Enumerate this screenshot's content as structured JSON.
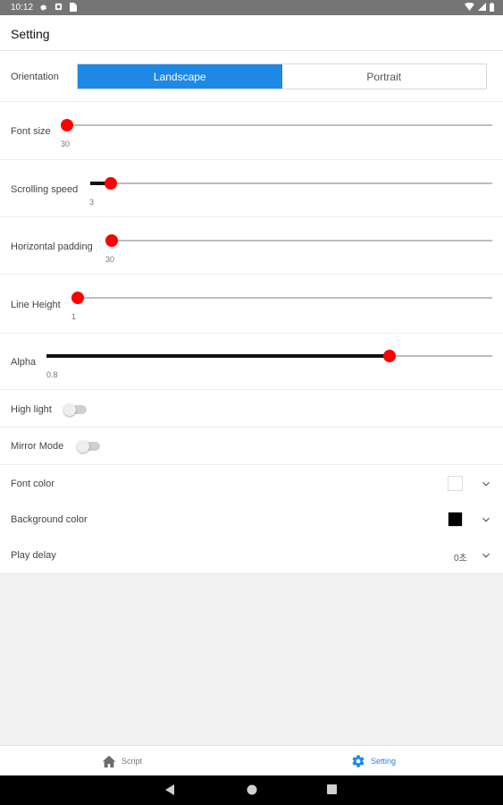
{
  "status": {
    "time": "10:12",
    "left_icons": [
      "gear-icon",
      "square-notification-icon",
      "sim-card-icon"
    ],
    "right_icons": [
      "wifi-icon",
      "signal-icon",
      "battery-icon"
    ]
  },
  "appbar": {
    "title": "Setting"
  },
  "orientation": {
    "label": "Orientation",
    "options": [
      "Landscape",
      "Portrait"
    ],
    "selected": "Landscape",
    "accent": "#1e88e5"
  },
  "sliders": {
    "font_size": {
      "label": "Font size",
      "value": "30",
      "position": 0.0
    },
    "scrolling_speed": {
      "label": "Scrolling speed",
      "value": "3",
      "position": 0.05
    },
    "horizontal_padding": {
      "label": "Horizontal padding",
      "value": "30",
      "position": 0.0
    },
    "line_height": {
      "label": "Line Height",
      "value": "1",
      "position": 0.0
    },
    "alpha": {
      "label": "Alpha",
      "value": "0.8",
      "position": 0.77
    }
  },
  "toggles": {
    "high_light": {
      "label": "High light",
      "on": false
    },
    "mirror_mode": {
      "label": "Mirror Mode",
      "on": false
    }
  },
  "colors": {
    "font_color": {
      "label": "Font color",
      "value": "#ffffff"
    },
    "background_color": {
      "label": "Background color",
      "value": "#000000"
    }
  },
  "play_delay": {
    "label": "Play delay",
    "value": "0초"
  },
  "slider_color": "#ff0000",
  "tabs": [
    {
      "label": "Script",
      "icon": "home-icon",
      "active": false
    },
    {
      "label": "Setting",
      "icon": "gear-icon",
      "active": true
    }
  ],
  "navbar": [
    "back-icon",
    "home-circle-icon",
    "recents-icon"
  ]
}
